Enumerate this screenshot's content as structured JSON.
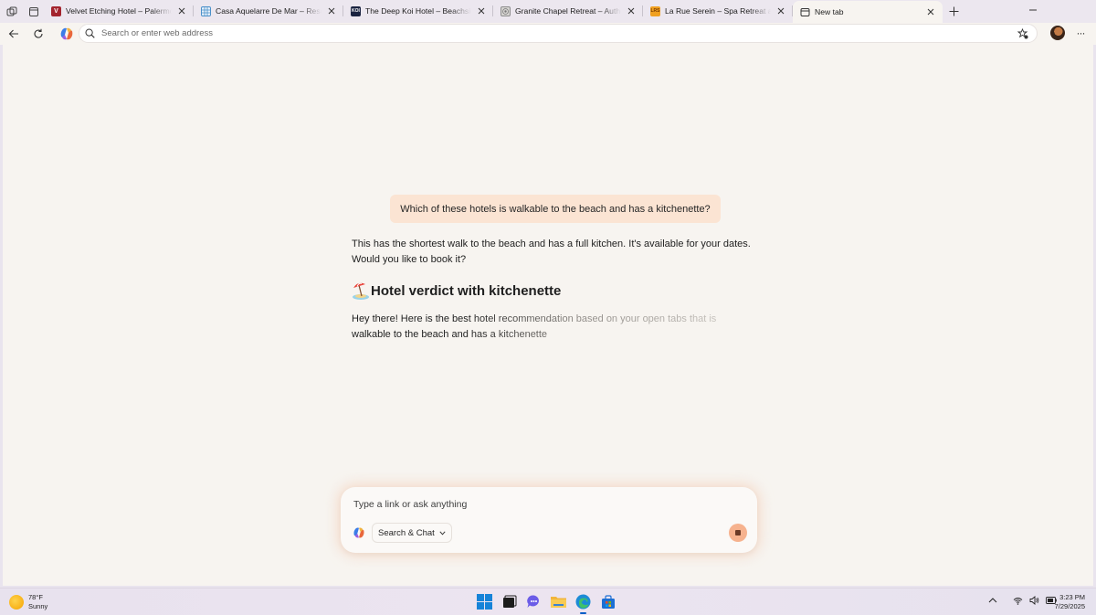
{
  "browser": {
    "tabs": [
      {
        "title": "Velvet Etching Hotel – Palermo Travel",
        "favicon": "v-logo",
        "color": "#a3232d",
        "active": false
      },
      {
        "title": "Casa Aquelarre De Mar – Resorts Network",
        "favicon": "grid-logo",
        "color": "#4a90c9",
        "active": false
      },
      {
        "title": "The Deep Koi Hotel – Beachside Travel",
        "favicon": "koi-logo",
        "color": "#1a2340",
        "active": false
      },
      {
        "title": "Granite Chapel Retreat – Authentic Stays",
        "favicon": "stone-logo",
        "color": "#8c8c8c",
        "active": false
      },
      {
        "title": "La Rue Serein – Spa Retreat and Hotel",
        "favicon": "lrs-logo",
        "color": "#f0a020",
        "active": false
      },
      {
        "title": "New tab",
        "favicon": "newtab-icon",
        "color": "#333333",
        "active": true
      }
    ],
    "address_placeholder": "Search or enter web address"
  },
  "chat": {
    "user_message": "Which of these hotels is walkable to the beach and has a kitchenette?",
    "answer_text": "This has the shortest walk to the beach and has a full kitchen. It's available for your dates. Would you like to book it?",
    "heading": "Hotel verdict with kitchenette",
    "heading_emoji": "beach-umbrella",
    "streaming_text": "Hey there! Here is the best hotel recommendation based on your open tabs that is walkable to the beach and has a kitchenette"
  },
  "composer": {
    "placeholder": "Type a link or ask anything",
    "mode_label": "Search & Chat"
  },
  "taskbar": {
    "weather_temp": "78°F",
    "weather_cond": "Sunny",
    "time": "3:23 PM",
    "date": "7/29/2025"
  },
  "colors": {
    "accent": "#f6b28e",
    "bubble": "#fbe4d3",
    "page_bg": "#f7f4f0"
  }
}
